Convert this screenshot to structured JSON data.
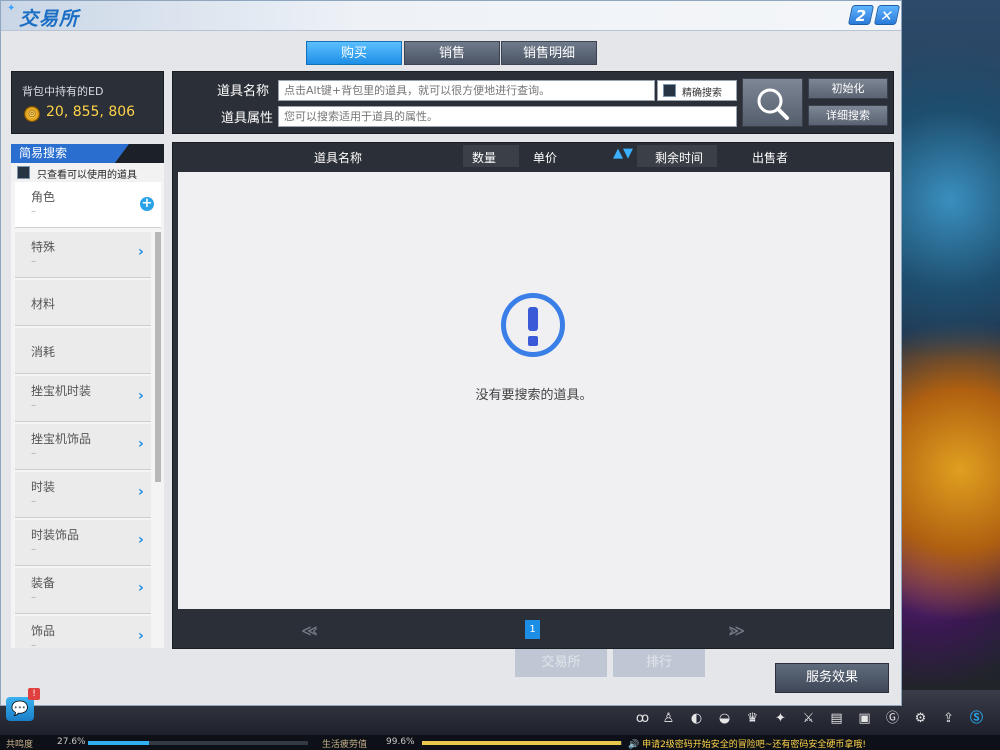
{
  "window": {
    "title": "交易所",
    "help_label": "2",
    "close_label": "✕"
  },
  "tabs": [
    {
      "label": "购买",
      "active": true
    },
    {
      "label": "销售",
      "active": false
    },
    {
      "label": "销售明细",
      "active": false
    }
  ],
  "ed": {
    "label": "背包中持有的ED",
    "amount": "20, 855, 806"
  },
  "search": {
    "name_label": "道具名称",
    "name_placeholder": "点击Alt键+背包里的道具，就可以很方便地进行查询。",
    "attr_label": "道具属性",
    "attr_placeholder": "您可以搜索适用于道具的属性。",
    "exact_label": "精确搜索",
    "reset_label": "初始化",
    "detail_label": "详细搜索"
  },
  "sidebar": {
    "simple_search_label": "简易搜索",
    "usable_only_label": "只查看可以使用的道具",
    "categories": [
      {
        "name": "角色",
        "sub": "–",
        "control": "plus"
      },
      {
        "name": "特殊",
        "sub": "–",
        "control": "arrow"
      },
      {
        "name": "材料",
        "sub": "",
        "control": "none"
      },
      {
        "name": "消耗",
        "sub": "",
        "control": "none"
      },
      {
        "name": "挫宝机时装",
        "sub": "–",
        "control": "arrow"
      },
      {
        "name": "挫宝机饰品",
        "sub": "–",
        "control": "arrow"
      },
      {
        "name": "时装",
        "sub": "–",
        "control": "arrow"
      },
      {
        "name": "时装饰品",
        "sub": "–",
        "control": "arrow"
      },
      {
        "name": "装备",
        "sub": "–",
        "control": "arrow"
      },
      {
        "name": "饰品",
        "sub": "–",
        "control": "arrow"
      }
    ]
  },
  "results": {
    "columns": [
      "道具名称",
      "数量",
      "单价",
      "剩余时间",
      "出售者"
    ],
    "sort_icon": "▲▼",
    "empty_message": "没有要搜索的道具。",
    "page": "1",
    "prev_label": "≪‹",
    "next_label": "›≫"
  },
  "background_buttons": [
    "交易所",
    "排行"
  ],
  "service_button": "服务效果",
  "chat": {
    "badge": "!"
  },
  "status": {
    "resonance_label": "共鸣度",
    "resonance_value": "27.6%",
    "resonance_fraction": 0.276,
    "fatigue_label": "生活疲劳值",
    "fatigue_value": "99.6%",
    "fatigue_fraction": 0.996,
    "notice": "申请2级密码开始安全的冒险吧~还有密码安全硬币拿哦!"
  },
  "tray_icons": [
    "feather-icon",
    "figure-icon",
    "bag-icon",
    "mask-icon",
    "gift-icon",
    "wing-icon",
    "sword-icon",
    "doc-icon",
    "box-icon",
    "g-badge-icon",
    "gear-person-icon",
    "gear-icon",
    "upload-icon",
    "s-logo-icon"
  ],
  "colors": {
    "accent": "#1d8ee6",
    "ed_gold": "#ffd24a",
    "notice": "#ffd54a"
  }
}
